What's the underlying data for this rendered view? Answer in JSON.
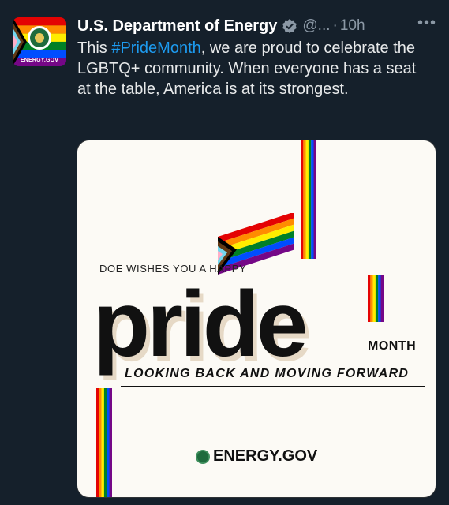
{
  "tweet": {
    "avatar_label": "ENERGY.GOV",
    "author_name": "U.S. Department of Energy",
    "handle": "@...",
    "separator": "·",
    "time": "10h",
    "more": "•••",
    "text_before": "This ",
    "hashtag": "#PrideMonth",
    "text_after": ", we are proud to celebrate the LGBTQ+ community. When everyone has a seat at the table, America is at its strongest."
  },
  "media": {
    "wish_text": "DOE WISHES YOU A HAPPY",
    "pride_text": "pride",
    "month_text": "MONTH",
    "tagline": "LOOKING BACK AND MOVING FORWARD",
    "brand": "ENERGY.GOV"
  },
  "colors": {
    "background": "#15202b",
    "hashtag": "#1d9bf0",
    "verified": "#1d9bf0",
    "rainbow": [
      "#e40303",
      "#ff8c00",
      "#ffed00",
      "#008026",
      "#004dff",
      "#750787"
    ]
  },
  "icons": {
    "verified": "verified-badge-icon",
    "more": "more-options-icon",
    "seal": "doe-seal-icon"
  }
}
